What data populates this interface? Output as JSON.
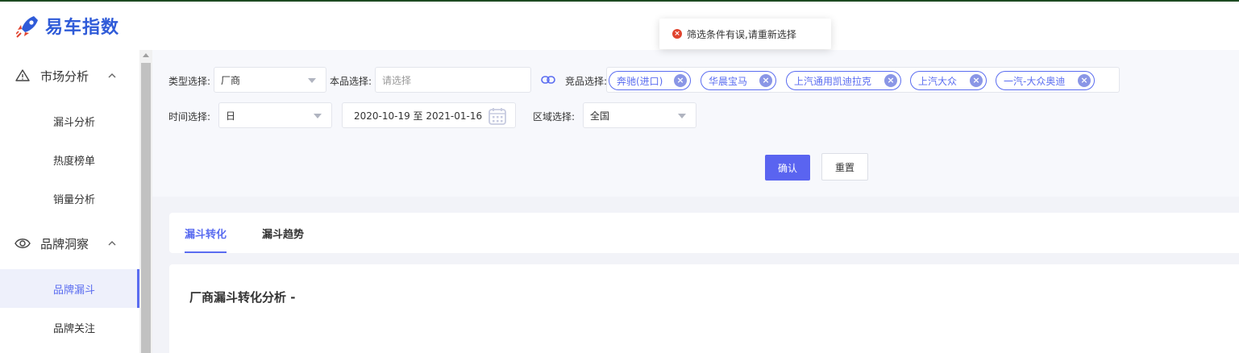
{
  "header": {
    "logo_text": "易车指数",
    "brand_color": "#2f5bd8"
  },
  "toast": {
    "icon": "error-icon",
    "message": "筛选条件有误,请重新选择",
    "color": "#e0432e"
  },
  "sidebar": {
    "groups": [
      {
        "label": "市场分析",
        "icon": "triangle-warning-icon",
        "expanded": true,
        "items": [
          {
            "label": "漏斗分析",
            "active": false
          },
          {
            "label": "热度榜单",
            "active": false
          },
          {
            "label": "销量分析",
            "active": false
          }
        ]
      },
      {
        "label": "品牌洞察",
        "icon": "eye-icon",
        "expanded": true,
        "items": [
          {
            "label": "品牌漏斗",
            "active": true
          },
          {
            "label": "品牌关注",
            "active": false
          }
        ]
      }
    ],
    "accent_color": "#5a6cf0"
  },
  "filters": {
    "type_label": "类型选择:",
    "type_value": "厂商",
    "own_label": "本品选择:",
    "own_placeholder": "请选择",
    "compete_label": "竞品选择:",
    "compete_tags": [
      "奔驰(进口)",
      "华晨宝马",
      "上汽通用凯迪拉克",
      "上汽大众",
      "一汽-大众奥迪"
    ],
    "time_label": "时间选择:",
    "time_value": "日",
    "date_range": "2020-10-19 至 2021-01-16",
    "region_label": "区域选择:",
    "region_value": "全国",
    "confirm_label": "确认",
    "reset_label": "重置"
  },
  "tabs": [
    {
      "label": "漏斗转化",
      "active": true
    },
    {
      "label": "漏斗趋势",
      "active": false
    }
  ],
  "content": {
    "title": "厂商漏斗转化分析 -"
  }
}
